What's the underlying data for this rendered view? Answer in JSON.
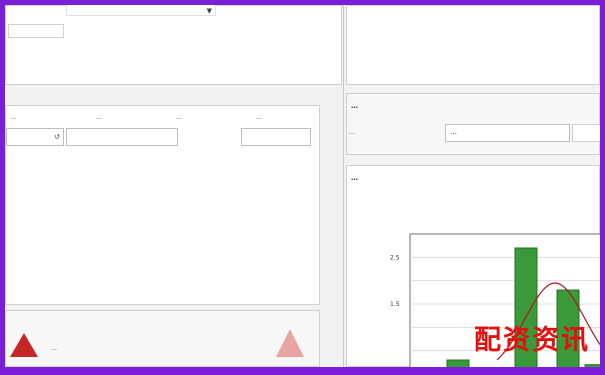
{
  "left_top": {
    "select_value": "▼"
  },
  "left_fields": {
    "col1": {
      "label": "…",
      "value": ""
    },
    "col2": {
      "label": "…",
      "value": ""
    },
    "col3": {
      "label": "…",
      "value": ""
    },
    "col4": {
      "label": "…",
      "value": ""
    }
  },
  "right_panel": {
    "section_title": "…",
    "param_label": "…",
    "param_value": "…",
    "chart_section_title": "…"
  },
  "footer_message": "…",
  "watermark": "配资资讯",
  "chart_data": {
    "type": "bar",
    "categories": [
      "",
      "",
      "",
      ""
    ],
    "values": [
      0.3,
      2.7,
      1.8,
      0.2
    ],
    "ytick_labels": [
      "1.5",
      "2.5"
    ],
    "ylim": [
      0,
      3
    ],
    "xlabel": "",
    "ylabel": "",
    "bar_color": "#3a9a3a",
    "curve_color": "#b01818"
  },
  "colors": {
    "border": "#7b1fd6",
    "background": "#f2f2f2",
    "panel": "#ffffff",
    "warning": "#c62828",
    "warning_light": "#e8a3a3",
    "watermark": "#e31010"
  }
}
